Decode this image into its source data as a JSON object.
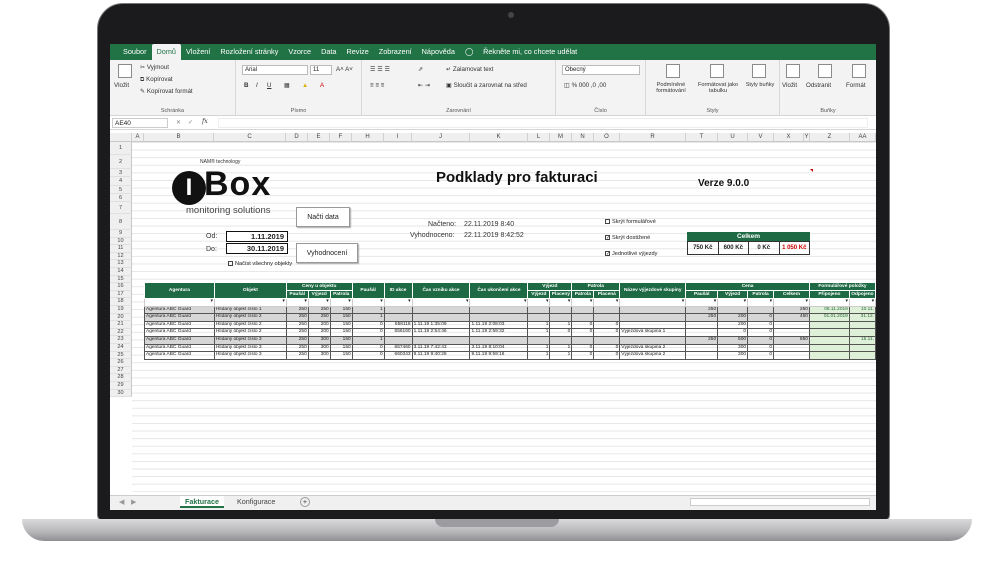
{
  "ribbon": {
    "tabs": [
      "Soubor",
      "Domů",
      "Vložení",
      "Rozložení stránky",
      "Vzorce",
      "Data",
      "Revize",
      "Zobrazení",
      "Nápověda"
    ],
    "tell_me": "Řekněte mi, co chcete udělat",
    "clipboard": {
      "paste": "Vložit",
      "cut": "Vyjmout",
      "copy": "Kopírovat",
      "format_painter": "Kopírovat formát",
      "group": "Schránka"
    },
    "font": {
      "name": "Arial",
      "size": "11",
      "group": "Písmo"
    },
    "alignment": {
      "wrap": "Zalamovat text",
      "merge": "Sloučit a zarovnat na střed",
      "group": "Zarovnání"
    },
    "number": {
      "format": "Obecný",
      "group": "Číslo"
    },
    "styles": {
      "conditional": "Podmíněné formátování",
      "table": "Formátovat jako tabulku",
      "cell_styles": "Styly buňky",
      "group": "Styly"
    },
    "cells": {
      "insert": "Vložit",
      "delete": "Odstranit",
      "format": "Formát",
      "group": "Buňky"
    }
  },
  "formula_bar": {
    "name_box": "AE40",
    "fx": "fx",
    "value": ""
  },
  "columns": [
    "A",
    "B",
    "C",
    "D",
    "E",
    "F",
    "H",
    "I",
    "J",
    "K",
    "L",
    "M",
    "N",
    "O",
    "R",
    "T",
    "U",
    "V",
    "X",
    "Y",
    "Z",
    "AA"
  ],
  "rows": [
    "1",
    "2",
    "3",
    "4",
    "5",
    "6",
    "7",
    "8",
    "9",
    "10",
    "11",
    "12",
    "13",
    "14",
    "15",
    "16",
    "17",
    "18",
    "19",
    "20",
    "21",
    "22",
    "23",
    "24",
    "25",
    "26",
    "27",
    "28",
    "29",
    "30"
  ],
  "logo": {
    "brand": "Box",
    "initial": "I",
    "sub": "monitoring solutions",
    "nam": "NAM® technology"
  },
  "title": "Podklady pro fakturaci",
  "version": "Verze 9.0.0",
  "buttons": {
    "load": "Načti data",
    "evaluate": "Vyhodnocení"
  },
  "dates": {
    "from_label": "Od:",
    "from": "1.11.2019",
    "to_label": "Do:",
    "to": "30.11.2019",
    "load_all": "Načíst všechny objekty"
  },
  "status": {
    "loaded_label": "Načteno:",
    "loaded": "22.11.2019 8:40",
    "evaluated_label": "Vyhodnoceno:",
    "evaluated": "22.11.2019 8:42:52"
  },
  "checkboxes": [
    {
      "label": "Skrýt formulářové",
      "checked": false
    },
    {
      "label": "Skrýt dostižené",
      "checked": true
    },
    {
      "label": "Jednotlivé výjezdy",
      "checked": true
    }
  ],
  "total": {
    "header": "Celkem",
    "values": [
      "750 Kč",
      "600 Kč",
      "0 Kč",
      "1 050 Kč"
    ]
  },
  "table": {
    "group_headers": {
      "prices": "Ceny u objektu",
      "exit": "Výjezd",
      "patrol": "Patrola",
      "price": "Cena",
      "formular": "Formulářové položky"
    },
    "headers": [
      "Agentura",
      "Objekt",
      "Paušál",
      "Výjezd",
      "Patrola",
      "Paušál",
      "ID akce",
      "Čas vzniku akce",
      "Čas ukončení akce",
      "Výjezd",
      "Placený",
      "Patrola",
      "Placená",
      "Název výjezdové skupiny",
      "Paušál",
      "Výjezd",
      "Patrola",
      "Celkem",
      "Připojeno",
      "Odpojeno"
    ],
    "rows": [
      {
        "agency": "Agentura ABC Guard",
        "object": "Hlídaný objekt číslo 1",
        "c1": "250",
        "c2": "250",
        "c3": "150",
        "pausal": "1",
        "id": "",
        "start": "",
        "end": "",
        "v": "",
        "vp": "",
        "p": "",
        "pp": "",
        "group": "",
        "cp": "250",
        "cv": "",
        "cpa": "",
        "ct": "250",
        "con": "08.11.2019",
        "dis": "10.11.",
        "gray": true
      },
      {
        "agency": "Agentura ABC Guard",
        "object": "Hlídaný objekt číslo 2",
        "c1": "250",
        "c2": "250",
        "c3": "150",
        "pausal": "1",
        "id": "",
        "start": "",
        "end": "",
        "v": "",
        "vp": "",
        "p": "",
        "pp": "",
        "group": "",
        "cp": "250",
        "cv": "200",
        "cpa": "0",
        "ct": "450",
        "con": "01.01.2019",
        "dis": "31.12.",
        "gray": true
      },
      {
        "agency": "Agentura ABC Guard",
        "object": "Hlídaný objekt číslo 2",
        "c1": "250",
        "c2": "200",
        "c3": "150",
        "pausal": "0",
        "id": "658118",
        "start": "1.11.19 1:35:09",
        "end": "1.11.19 2:08:03",
        "v": "1",
        "vp": "1",
        "p": "0",
        "pp": "0",
        "group": "",
        "cp": "",
        "cv": "200",
        "cpa": "0",
        "ct": "",
        "con": "",
        "dis": "",
        "gray": false
      },
      {
        "agency": "Agentura ABC Guard",
        "object": "Hlídaný objekt číslo 2",
        "c1": "250",
        "c2": "200",
        "c3": "150",
        "pausal": "0",
        "id": "656160",
        "start": "1.11.19 2:54:46",
        "end": "1.11.19 2:59:32",
        "v": "1",
        "vp": "0",
        "p": "0",
        "pp": "0",
        "group": "Výjezdová skupina 1",
        "cp": "",
        "cv": "0",
        "cpa": "0",
        "ct": "",
        "con": "",
        "dis": "",
        "gray": false
      },
      {
        "agency": "Agentura ABC Guard",
        "object": "Hlídaný objekt číslo 3",
        "c1": "250",
        "c2": "300",
        "c3": "150",
        "pausal": "1",
        "id": "",
        "start": "",
        "end": "",
        "v": "",
        "vp": "",
        "p": "",
        "pp": "",
        "group": "",
        "cp": "250",
        "cv": "600",
        "cpa": "0",
        "ct": "850",
        "con": "",
        "dis": "15.11.",
        "gray": true
      },
      {
        "agency": "Agentura ABC Guard",
        "object": "Hlídaný objekt číslo 3",
        "c1": "250",
        "c2": "300",
        "c3": "150",
        "pausal": "0",
        "id": "657460",
        "start": "3.11.19 7:42:43",
        "end": "3.11.19 8:10:04",
        "v": "1",
        "vp": "1",
        "p": "0",
        "pp": "0",
        "group": "Výjezdová skupina 2",
        "cp": "",
        "cv": "300",
        "cpa": "0",
        "ct": "",
        "con": "",
        "dis": "",
        "gray": false
      },
      {
        "agency": "Agentura ABC Guard",
        "object": "Hlídaný objekt číslo 3",
        "c1": "250",
        "c2": "300",
        "c3": "150",
        "pausal": "0",
        "id": "660343",
        "start": "9.11.19 9:40:28",
        "end": "9.11.19 9:59:16",
        "v": "1",
        "vp": "1",
        "p": "0",
        "pp": "0",
        "group": "Výjezdová skupina 2",
        "cp": "",
        "cv": "300",
        "cpa": "0",
        "ct": "",
        "con": "",
        "dis": "",
        "gray": false
      }
    ]
  },
  "sheets": {
    "active": "Fakturace",
    "other": "Konfigurace",
    "add": "+"
  }
}
